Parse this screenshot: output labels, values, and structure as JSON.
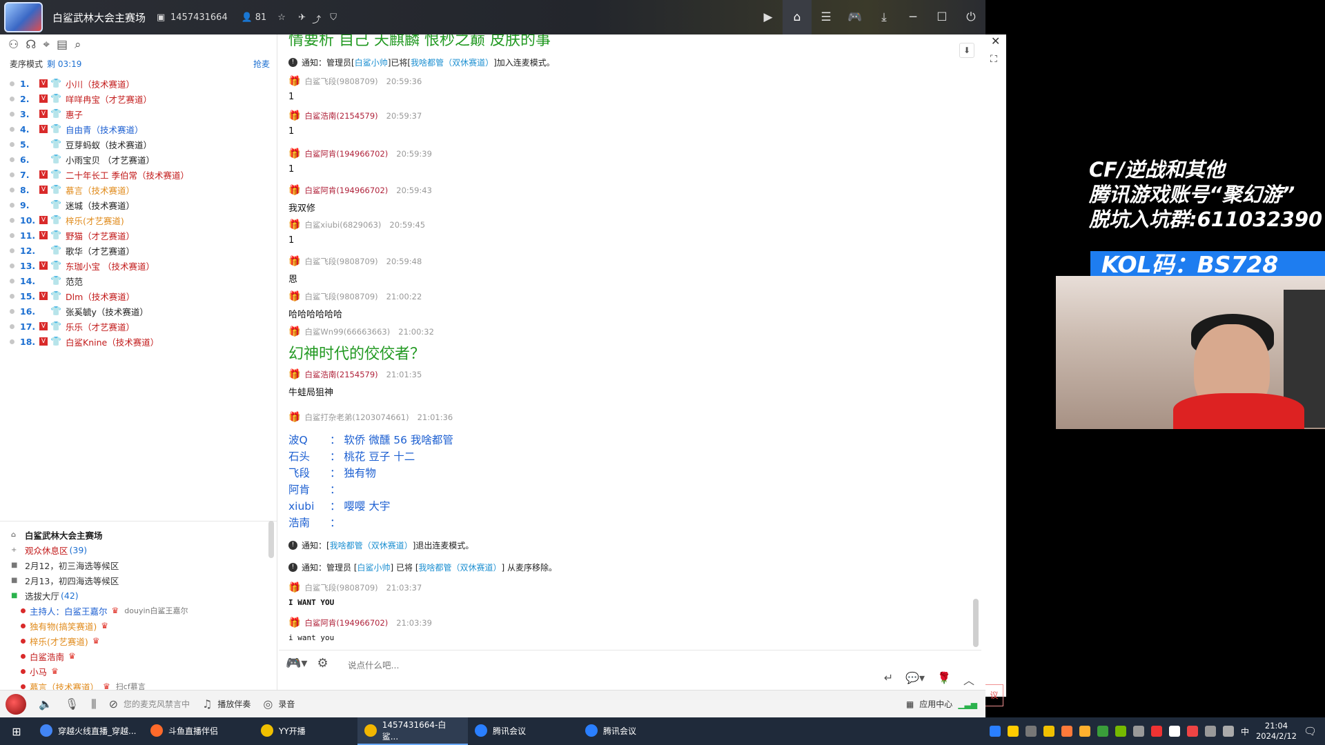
{
  "titlebar": {
    "room_name": "白鲨武林大会主赛场",
    "room_id": "1457431664",
    "viewers": "81"
  },
  "left": {
    "mic_mode_label": "麦序模式",
    "mic_time": "剩 03:19",
    "grab_mic": "抢麦",
    "queue": [
      {
        "num": "1.",
        "name": "小川（技术赛道）",
        "color": "red"
      },
      {
        "num": "2.",
        "name": "咩咩冉宝（才艺赛道）",
        "color": "red"
      },
      {
        "num": "3.",
        "name": "惠子",
        "color": "red"
      },
      {
        "num": "4.",
        "name": "自由青（技术赛道）",
        "color": "blue"
      },
      {
        "num": "5.",
        "name": "豆芽蚂蚁（技术赛道）",
        "color": "black"
      },
      {
        "num": "6.",
        "name": "小雨宝贝 （才艺赛道）",
        "color": "black"
      },
      {
        "num": "7.",
        "name": "二十年长工 季伯常（技术赛道）",
        "color": "red"
      },
      {
        "num": "8.",
        "name": "慕言（技术赛道）",
        "color": "orange"
      },
      {
        "num": "9.",
        "name": "迷城（技术赛道）",
        "color": "black"
      },
      {
        "num": "10.",
        "name": "梓乐(才艺赛道)",
        "color": "orange"
      },
      {
        "num": "11.",
        "name": "野猫（才艺赛道）",
        "color": "red"
      },
      {
        "num": "12.",
        "name": "歌华（才艺赛道）",
        "color": "black"
      },
      {
        "num": "13.",
        "name": "东珈小宝 （技术赛道）",
        "color": "red"
      },
      {
        "num": "14.",
        "name": "范范",
        "color": "black"
      },
      {
        "num": "15.",
        "name": "Dlm（技术赛道）",
        "color": "red"
      },
      {
        "num": "16.",
        "name": "张奚毓y（技术赛道）",
        "color": "black"
      },
      {
        "num": "17.",
        "name": "乐乐（才艺赛道）",
        "color": "red"
      },
      {
        "num": "18.",
        "name": "白鲨Knine（技术赛道）",
        "color": "red"
      }
    ],
    "channels": {
      "main": "白鲨武林大会主赛场",
      "rest_area": "观众休息区",
      "rest_count": "(39)",
      "feb12": "2月12，初三海选等候区",
      "feb13": "2月13，初四海选等候区",
      "hall": "选拔大厅",
      "hall_count": "(42)",
      "host": "主持人：白鲨王嘉尔",
      "host_side": "douyin白鲨王嘉尔",
      "m1": "独有物(搞笑赛道)",
      "m2": "梓乐(才艺赛道)",
      "m3": "白鲨浩南",
      "m4": "小马",
      "m5": "慕言（技术赛道）",
      "m5_side": "扫cf慕言"
    }
  },
  "chat": {
    "top_cut": "情要析 自己 天麒麟 恨秒之巅 皮肤的事",
    "notice1": {
      "prefix": "通知：管理员[",
      "admin": "白鲨小帅",
      "mid": "]已将[",
      "user": "我啥都管（双休赛道）",
      "suffix": "]加入连麦模式。"
    },
    "messages": [
      {
        "name": "白鲨飞段(9808709)",
        "time": "20:59:36",
        "text": "1"
      },
      {
        "name": "白鲨浩南(2154579)",
        "time": "20:59:37",
        "text": "1"
      },
      {
        "name": "白鲨阿肯(194966702)",
        "time": "20:59:39",
        "text": "1"
      },
      {
        "name": "白鲨阿肯(194966702)",
        "time": "20:59:43",
        "text": "我双修"
      },
      {
        "name": "白鲨xiubi(6829063)",
        "time": "20:59:45",
        "text": "1"
      },
      {
        "name": "白鲨飞段(9808709)",
        "time": "20:59:48",
        "text": "恩"
      },
      {
        "name": "白鲨飞段(9808709)",
        "time": "21:00:22",
        "text": "哈哈哈哈哈哈"
      },
      {
        "name": "白鲨Wn99(66663663)",
        "time": "21:00:32",
        "text": "幻神时代的佼佼者？"
      },
      {
        "name": "白鲨浩南(2154579)",
        "time": "21:01:35",
        "text": "牛蛙局狙神"
      },
      {
        "name": "白鲨打杂老弟(1203074661)",
        "time": "21:01:36",
        "text": ""
      }
    ],
    "lines": [
      {
        "k": "波Q",
        "v": "：  软侨 微醺  56  我啥都管"
      },
      {
        "k": "石头",
        "v": "：  桃花 豆子 十二"
      },
      {
        "k": "飞段",
        "v": "：  独有物"
      },
      {
        "k": "阿肯",
        "v": "："
      },
      {
        "k": "xiubi",
        "v": "：  嘤嘤 大宇"
      },
      {
        "k": "浩南",
        "v": "："
      }
    ],
    "notice2": {
      "prefix": "通知：[",
      "user": "我啥都管（双休赛道）",
      "suffix": "]退出连麦模式。"
    },
    "notice3": {
      "prefix": "通知：管理员 [",
      "admin": "白鲨小帅",
      "mid": "] 已将 [",
      "user": "我啥都管（双休赛道）",
      "suffix": "] 从麦序移除。"
    },
    "messages2": [
      {
        "name": "白鲨飞段(9808709)",
        "time": "21:03:37",
        "text": "I WANT YOU"
      },
      {
        "name": "白鲨阿肯(194966702)",
        "time": "21:03:39",
        "text": "i want you"
      }
    ]
  },
  "input": {
    "placeholder": "说点什么吧..."
  },
  "bottombar": {
    "mic_muted": "您的麦克风禁言中",
    "play_music": "播放伴奏",
    "record": "录音",
    "app_center": "应用中心"
  },
  "overlay": {
    "line1": "CF/逆战和其他",
    "line2": "腾讯游戏账号“聚幻游”",
    "line3": "脱坑入坑群:611032390",
    "kol": "KOL码：BS728",
    "float_btn": "议"
  },
  "taskbar": {
    "tasks": [
      "穿越火线直播_穿越...",
      "斗鱼直播伴侣",
      "YY开播",
      "1457431664-白鲨...",
      "腾讯会议",
      "腾讯会议"
    ],
    "ime": "中",
    "time": "21:04",
    "date": "2024/2/12"
  }
}
